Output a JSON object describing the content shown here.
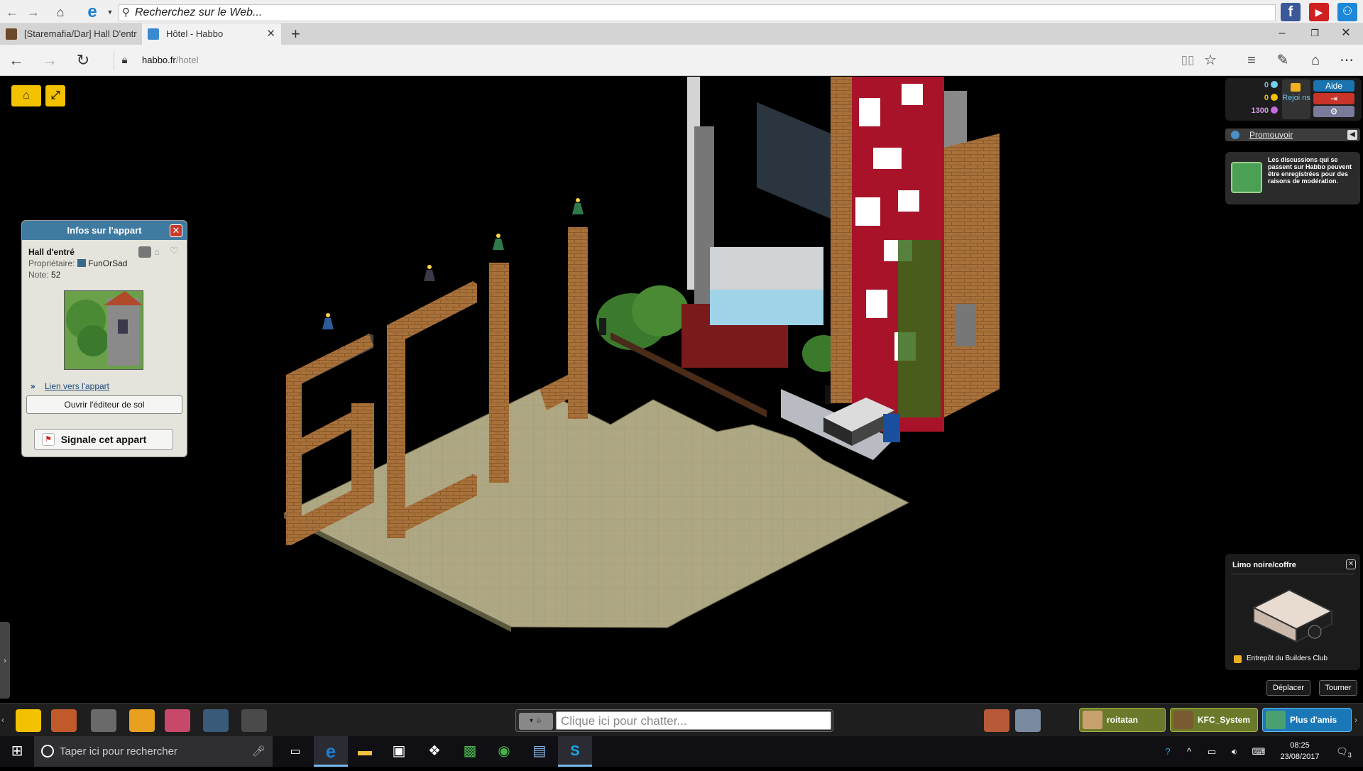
{
  "ie_toolbar": {
    "search_placeholder": "Recherchez sur le Web...",
    "social": [
      "f",
      "▶",
      "⚇"
    ]
  },
  "tabs": [
    {
      "title": "[Staremafia/Dar] Hall D'entr",
      "active": false
    },
    {
      "title": "Hôtel - Habbo",
      "active": true
    }
  ],
  "address": {
    "domain": "habbo.fr",
    "path": "/hotel"
  },
  "room_info": {
    "header": "Infos sur l'appart",
    "name": "Hall d'entré",
    "owner_label": "Propriétaire:",
    "owner": "FunOrSad",
    "rating_label": "Note:",
    "rating": "52",
    "link": "Lien vers l'appart",
    "floor_editor": "Ouvrir l'éditeur de sol",
    "report": "Signale cet appart"
  },
  "currency": {
    "diamonds": "0",
    "credits": "0",
    "duckets": "1300",
    "join_label": "Rejoi ns",
    "help": "Aide"
  },
  "promote": {
    "label": "Promouvoir",
    "moderation": "Les discussions qui se passent sur Habbo peuvent être enregistrées pour des raisons de modération."
  },
  "furni": {
    "title": "Limo noire/coffre",
    "owner": "Entrepôt du Builders Club",
    "move": "Déplacer",
    "rotate": "Tourner"
  },
  "chat": {
    "placeholder": "Clique ici pour chatter..."
  },
  "friends": [
    {
      "name": "roitatan"
    },
    {
      "name": "KFC_System"
    },
    {
      "name": "Plus d'amis"
    }
  ],
  "taskbar": {
    "search": "Taper ici pour rechercher",
    "time": "08:25",
    "date": "23/08/2017",
    "notifications": "3"
  },
  "colors": {
    "room_header": "#3f7aa1",
    "floor": "#a8a27a",
    "wall_red": "#a8132a",
    "brick": "#8a5a2a"
  }
}
